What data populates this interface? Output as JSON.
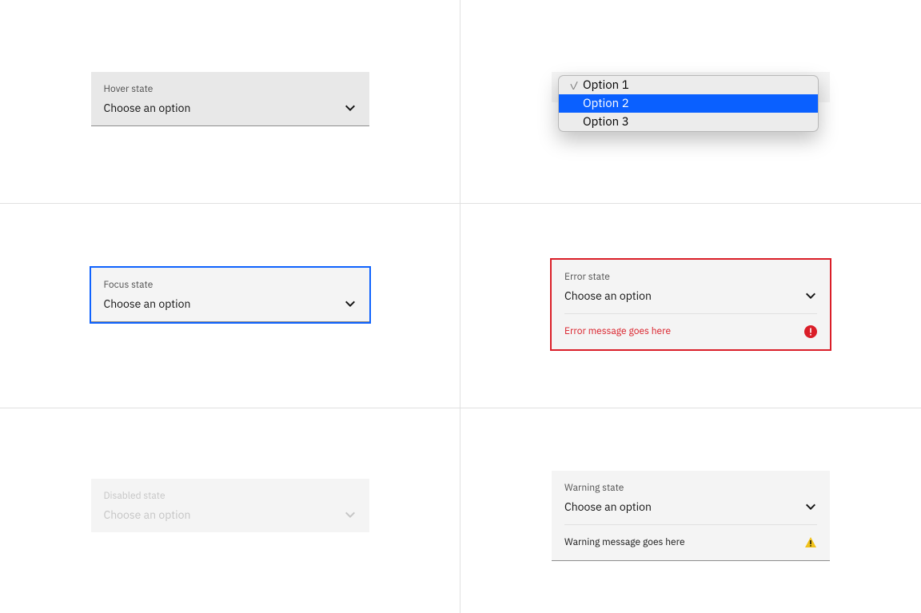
{
  "hover": {
    "label": "Hover state",
    "value": "Choose an option"
  },
  "focus": {
    "label": "Focus state",
    "value": "Choose an option"
  },
  "disabled": {
    "label": "Disabled state",
    "value": "Choose an option"
  },
  "open": {
    "options": [
      "Option 1",
      "Option 2",
      "Option 3"
    ],
    "selectedIndex": 1,
    "checkedIndex": 0
  },
  "error": {
    "label": "Error state",
    "value": "Choose an option",
    "message": "Error message goes here"
  },
  "warning": {
    "label": "Warning state",
    "value": "Choose an option",
    "message": "Warning message goes here"
  }
}
